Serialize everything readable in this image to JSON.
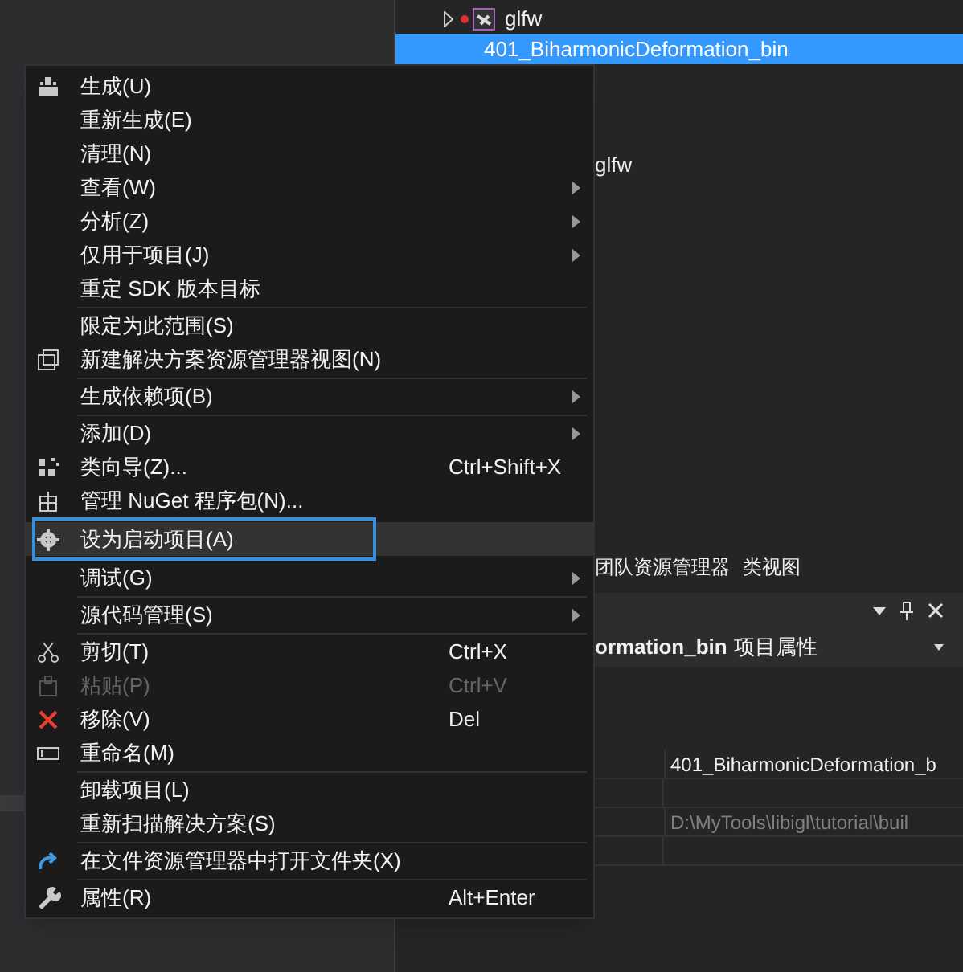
{
  "tree": [
    {
      "label": "glfw",
      "selected": false
    },
    {
      "label": "401_BiharmonicDeformation_bin",
      "selected": true
    },
    {
      "label": "glfw",
      "selected": false
    }
  ],
  "panel_tabs": [
    {
      "label": "团队资源管理器",
      "selected": false
    },
    {
      "label": "类视图",
      "selected": false
    }
  ],
  "properties": {
    "title": "ormation_bin",
    "subtitle": "项目属性",
    "rows": [
      {
        "value": "401_BiharmonicDeformation_b",
        "disabled": false
      },
      {
        "value": "D:\\MyTools\\libigl\\tutorial\\buil",
        "disabled": true
      }
    ]
  },
  "menu": [
    {
      "kind": "item",
      "label": "生成(U)",
      "submenu": false,
      "disabled": false,
      "selected": false
    },
    {
      "kind": "item",
      "label": "重新生成(E)",
      "submenu": false,
      "disabled": false,
      "selected": false
    },
    {
      "kind": "item",
      "label": "清理(N)",
      "submenu": false,
      "disabled": false,
      "selected": false
    },
    {
      "kind": "item",
      "label": "查看(W)",
      "submenu": true,
      "disabled": false,
      "selected": false
    },
    {
      "kind": "item",
      "label": "分析(Z)",
      "submenu": true,
      "disabled": false,
      "selected": false
    },
    {
      "kind": "item",
      "label": "仅用于项目(J)",
      "submenu": true,
      "disabled": false,
      "selected": false
    },
    {
      "kind": "item",
      "label": "重定 SDK 版本目标",
      "submenu": false,
      "disabled": false,
      "selected": false
    },
    {
      "kind": "separator"
    },
    {
      "kind": "item",
      "label": "限定为此范围(S)",
      "submenu": false,
      "disabled": false,
      "selected": false
    },
    {
      "kind": "item",
      "label": "新建解决方案资源管理器视图(N)",
      "submenu": false,
      "disabled": false,
      "selected": false
    },
    {
      "kind": "separator"
    },
    {
      "kind": "item",
      "label": "生成依赖项(B)",
      "submenu": true,
      "disabled": false,
      "selected": false
    },
    {
      "kind": "separator"
    },
    {
      "kind": "item",
      "label": "添加(D)",
      "submenu": true,
      "disabled": false,
      "selected": false
    },
    {
      "kind": "item",
      "label": "类向导(Z)...",
      "shortcut": "Ctrl+Shift+X",
      "submenu": false,
      "disabled": false,
      "selected": false
    },
    {
      "kind": "item",
      "label": "管理 NuGet 程序包(N)...",
      "submenu": false,
      "disabled": false,
      "selected": false
    },
    {
      "kind": "item",
      "label": "设为启动项目(A)",
      "submenu": false,
      "disabled": false,
      "selected": true
    },
    {
      "kind": "item",
      "label": "调试(G)",
      "submenu": true,
      "disabled": false,
      "selected": false
    },
    {
      "kind": "separator"
    },
    {
      "kind": "item",
      "label": "源代码管理(S)",
      "submenu": true,
      "disabled": false,
      "selected": false
    },
    {
      "kind": "separator"
    },
    {
      "kind": "item",
      "label": "剪切(T)",
      "shortcut": "Ctrl+X",
      "submenu": false,
      "disabled": false,
      "selected": false
    },
    {
      "kind": "item",
      "label": "粘贴(P)",
      "shortcut": "Ctrl+V",
      "submenu": false,
      "disabled": true,
      "selected": false
    },
    {
      "kind": "item",
      "label": "移除(V)",
      "shortcut": "Del",
      "submenu": false,
      "disabled": false,
      "selected": false
    },
    {
      "kind": "item",
      "label": "重命名(M)",
      "submenu": false,
      "disabled": false,
      "selected": false
    },
    {
      "kind": "separator"
    },
    {
      "kind": "item",
      "label": "卸载项目(L)",
      "submenu": false,
      "disabled": false,
      "selected": false
    },
    {
      "kind": "item",
      "label": "重新扫描解决方案(S)",
      "submenu": false,
      "disabled": false,
      "selected": false
    },
    {
      "kind": "separator"
    },
    {
      "kind": "item",
      "label": "在文件资源管理器中打开文件夹(X)",
      "submenu": false,
      "disabled": false,
      "selected": false
    },
    {
      "kind": "separator"
    },
    {
      "kind": "item",
      "label": "属性(R)",
      "shortcut": "Alt+Enter",
      "submenu": false,
      "disabled": false,
      "selected": false
    }
  ]
}
